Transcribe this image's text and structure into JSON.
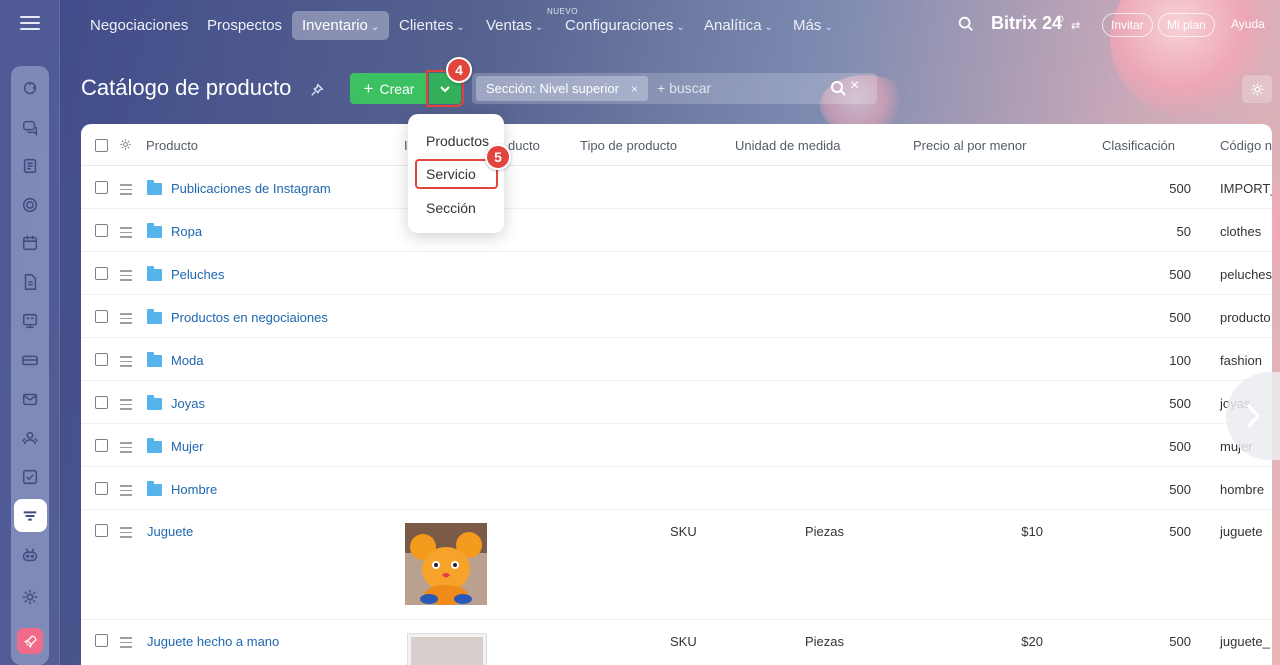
{
  "nav": {
    "items": [
      {
        "label": "Negociaciones",
        "chevron": false
      },
      {
        "label": "Prospectos",
        "chevron": false
      },
      {
        "label": "Inventario",
        "chevron": true
      },
      {
        "label": "Clientes",
        "chevron": true
      },
      {
        "label": "Ventas",
        "chevron": true
      },
      {
        "label": "Configuraciones",
        "chevron": true
      },
      {
        "label": "Analítica",
        "chevron": true
      },
      {
        "label": "Más",
        "chevron": true
      }
    ],
    "new_badge": "NUEVO",
    "chevron_glyph": "⌄"
  },
  "brand": {
    "name": "Bitrix 24",
    "clock": "⊙",
    "switch": "⇄"
  },
  "top_actions": {
    "invite": "Invitar",
    "plan": "Mi plan",
    "help": "Ayuda"
  },
  "header": {
    "title": "Catálogo de producto",
    "create_label": "Crear",
    "create_plus": "+",
    "filter_chip": "Sección: Nivel superior",
    "chip_close": "×",
    "search_placeholder": "+ buscar",
    "search_clear": "×"
  },
  "menu": {
    "items": [
      "Productos",
      "Servicio",
      "Sección"
    ],
    "highlighted": "Servicio"
  },
  "steps": {
    "dropdown_step": "4",
    "servicio_step": "5"
  },
  "table": {
    "columns": [
      "Producto",
      "I",
      "ducto",
      "Tipo de producto",
      "Unidad de medida",
      "Precio al por menor",
      "Clasificación",
      "Código n"
    ],
    "rows": [
      {
        "name": "Publicaciones de Instagram",
        "folder": true,
        "tipo": "",
        "unidad": "",
        "precio": "",
        "clasificacion": "500",
        "codigo": "IMPORT_"
      },
      {
        "name": "Ropa",
        "folder": true,
        "tipo": "",
        "unidad": "",
        "precio": "",
        "clasificacion": "50",
        "codigo": "clothes"
      },
      {
        "name": "Peluches",
        "folder": true,
        "tipo": "",
        "unidad": "",
        "precio": "",
        "clasificacion": "500",
        "codigo": "peluches"
      },
      {
        "name": "Productos en negociaiones",
        "folder": true,
        "tipo": "",
        "unidad": "",
        "precio": "",
        "clasificacion": "500",
        "codigo": "producto"
      },
      {
        "name": "Moda",
        "folder": true,
        "tipo": "",
        "unidad": "",
        "precio": "",
        "clasificacion": "100",
        "codigo": "fashion"
      },
      {
        "name": "Joyas",
        "folder": true,
        "tipo": "",
        "unidad": "",
        "precio": "",
        "clasificacion": "500",
        "codigo": "joyas"
      },
      {
        "name": "Mujer",
        "folder": true,
        "tipo": "",
        "unidad": "",
        "precio": "",
        "clasificacion": "500",
        "codigo": "mujer"
      },
      {
        "name": "Hombre",
        "folder": true,
        "tipo": "",
        "unidad": "",
        "precio": "",
        "clasificacion": "500",
        "codigo": "hombre"
      },
      {
        "name": "Juguete",
        "folder": false,
        "tipo": "SKU",
        "unidad": "Piezas",
        "precio": "$10",
        "clasificacion": "500",
        "codigo": "juguete"
      },
      {
        "name": "Juguete hecho a mano",
        "folder": false,
        "tipo": "SKU",
        "unidad": "Piezas",
        "precio": "$20",
        "clasificacion": "500",
        "codigo": "juguete_"
      }
    ]
  },
  "icons": {
    "rail": [
      "menu-icon",
      "activity-icon",
      "chat-icon",
      "feed-icon",
      "crm-icon",
      "calendar-icon",
      "document-icon",
      "board-icon",
      "storage-icon",
      "mail-icon",
      "contacts-icon",
      "tasks-icon",
      "inventory-icon",
      "robot-icon",
      "settings-icon",
      "rocket-icon"
    ]
  },
  "colors": {
    "accent_green": "#3bc162",
    "step_red": "#e0443c",
    "link_blue": "#2067b0",
    "folder_blue": "#55b4ea"
  }
}
